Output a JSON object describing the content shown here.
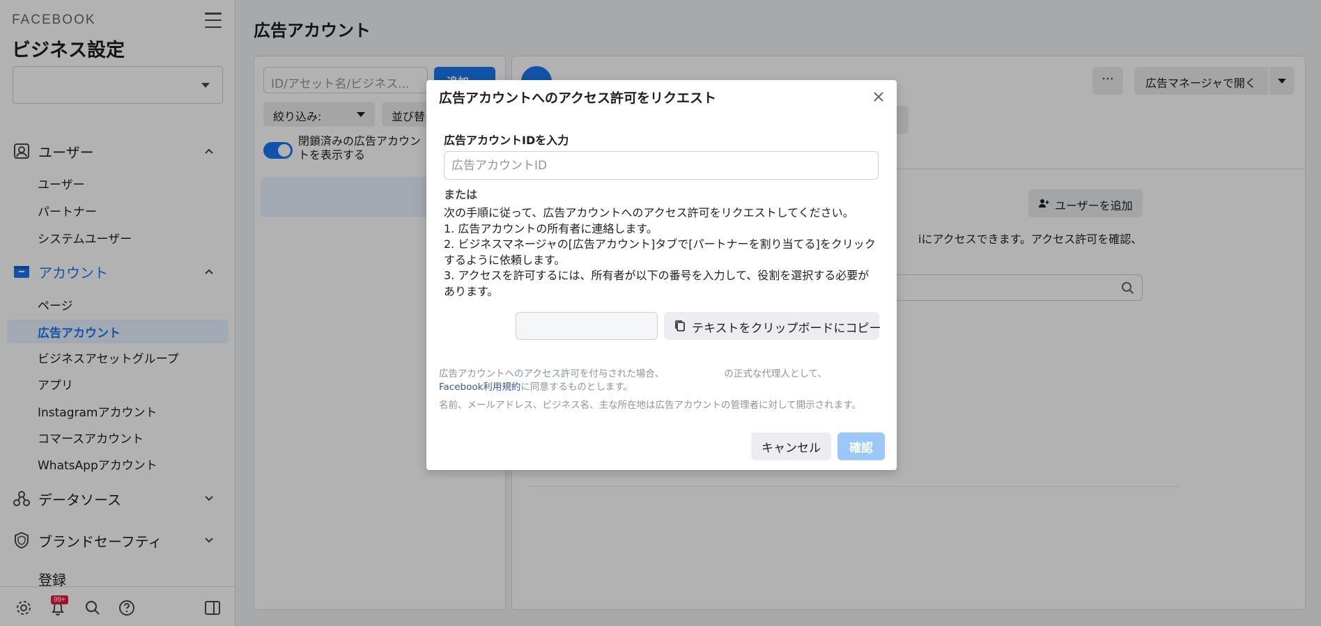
{
  "sidebar": {
    "brand": "FACEBOOK",
    "title": "ビジネス設定",
    "sections": [
      {
        "label": "ユーザー"
      },
      {
        "label": "アカウント"
      },
      {
        "label": "データソース"
      },
      {
        "label": "ブランドセーフティ"
      },
      {
        "label": "登録"
      }
    ],
    "user_items": [
      "ユーザー",
      "パートナー",
      "システムユーザー"
    ],
    "account_items": [
      "ページ",
      "広告アカウント",
      "ビジネスアセットグループ",
      "アプリ",
      "Instagramアカウント",
      "コマースアカウント",
      "WhatsAppアカウント"
    ],
    "notification_badge": "99+"
  },
  "main": {
    "title": "広告アカウント",
    "search_placeholder": "ID/アセット名/ビジネス...",
    "add_label": "追加",
    "filter_label": "絞り込み:",
    "sort_label": "並び替",
    "toggle_label": "閉鎖済みの広告アカウントを表示する",
    "more_label": "···",
    "open_label": "広告マネージャで開く",
    "add_user_label": "ユーザーを追加",
    "access_text": "iにアクセスできます。アクセス許可を確認、"
  },
  "modal": {
    "title": "広告アカウントへのアクセス許可をリクエスト",
    "field_label": "広告アカウントIDを入力",
    "input_placeholder": "広告アカウントID",
    "or": "または",
    "instructions": [
      "次の手順に従って、広告アカウントへのアクセス許可をリクエストしてください。",
      "1. 広告アカウントの所有者に連絡します。",
      "2. ビジネスマネージャの[広告アカウント]タブで[パートナーを割り当てる]をクリックするように依頼します。",
      "3. アクセスを許可するには、所有者が以下の番号を入力して、役割を選択する必要があります。"
    ],
    "copy_label": "テキストをクリップボードにコピー",
    "fine_print_1a": "広告アカウントへのアクセス許可を付与された場合、",
    "fine_print_1b": "の正式な代理人として、",
    "fine_print_link": "Facebook利用規約",
    "fine_print_2": "に同意するものとします。",
    "fine_print_3": "名前、メールアドレス、ビジネス名、主な所在地は広告アカウントの管理者に対して開示されます。",
    "cancel_label": "キャンセル",
    "confirm_label": "確認"
  },
  "colors": {
    "accent": "#1877f2",
    "overlay": "rgba(0,0,0,0.3)"
  }
}
